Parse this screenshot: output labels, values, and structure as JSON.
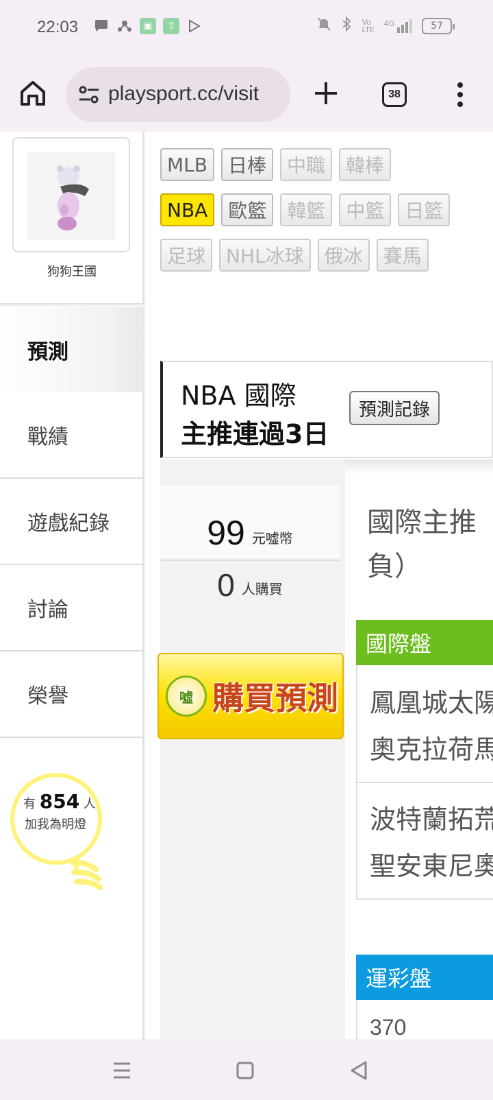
{
  "status": {
    "time": "22:03",
    "battery": "57",
    "network": "4G",
    "volte": "Vo LTE"
  },
  "browser": {
    "url": "playsport.cc/visit",
    "tab_count": "38"
  },
  "profile": {
    "name": "狗狗王國"
  },
  "sidebar": {
    "items": [
      {
        "label": "預測",
        "active": true
      },
      {
        "label": "戰績",
        "active": false
      },
      {
        "label": "遊戲紀錄",
        "active": false
      },
      {
        "label": "討論",
        "active": false
      },
      {
        "label": "榮譽",
        "active": false
      }
    ]
  },
  "followers": {
    "prefix": "有",
    "count": "854",
    "suffix": "人",
    "line2": "加我為明燈"
  },
  "sports": {
    "row1": [
      "MLB",
      "日棒",
      "中職",
      "韓棒"
    ],
    "row2": [
      "NBA",
      "歐籃",
      "韓籃",
      "中籃",
      "日籃"
    ],
    "row3": [
      "足球",
      "NHL冰球",
      "俄冰",
      "賽馬"
    ]
  },
  "headline": {
    "line1": "NBA 國際",
    "line2": "主推連過3日",
    "record_button": "預測記錄"
  },
  "price": {
    "amount": "99",
    "unit": "元噓幣",
    "buyers": "0",
    "buyers_unit": "人購買",
    "buy_button": "購買預測",
    "buy_logo": "噓"
  },
  "prediction": {
    "title_line1": "國際主推",
    "title_line2": "負）",
    "intl_section": "國際盤",
    "matches": [
      {
        "team1": "鳳凰城太陽",
        "team2": "奧克拉荷馬"
      },
      {
        "team1": "波特蘭拓荒",
        "team2": "聖安東尼奧"
      }
    ],
    "sports_lottery_section": "運彩盤",
    "next_value": "370"
  }
}
